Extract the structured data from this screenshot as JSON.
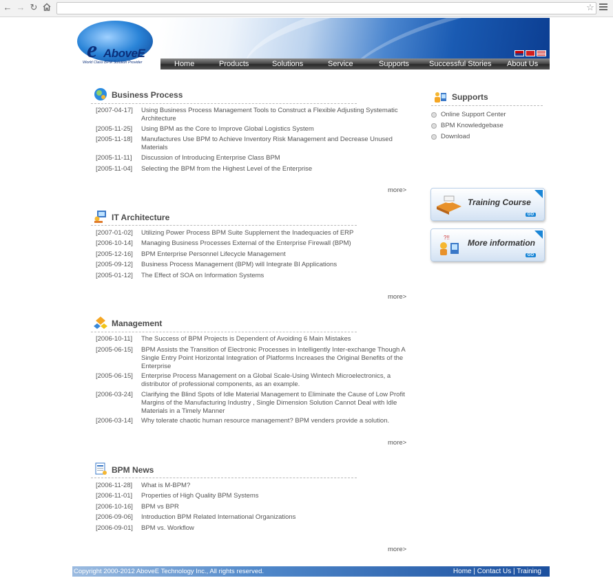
{
  "browser": {
    "address": ""
  },
  "header": {
    "logo_text": "AboveE",
    "logo_tagline": "World Class BPM Solution Provider",
    "nav": [
      "Home",
      "Products",
      "Solutions",
      "Service",
      "Supports",
      "Successful Stories",
      "About Us"
    ],
    "colors": {
      "nav_bar": "#3a3a3a",
      "banner_blue": "#1a5bb3"
    }
  },
  "sections": [
    {
      "title": "Business Process",
      "icon": "globe-people-icon",
      "more": "more>",
      "items": [
        {
          "date": "[2007-04-17]",
          "title": "Using Business Process Management Tools to Construct a Flexible Adjusting Systematic Architecture"
        },
        {
          "date": "[2005-11-25]",
          "title": "Using BPM as the Core to Improve Global Logistics System"
        },
        {
          "date": "[2005-11-18]",
          "title": "Manufactures Use BPM to Achieve Inventory Risk Management and Decrease Unused Materials"
        },
        {
          "date": "[2005-11-11]",
          "title": "Discussion of Introducing Enterprise Class BPM"
        },
        {
          "date": "[2005-11-04]",
          "title": "Selecting the BPM from the Highest Level of the Enterprise"
        }
      ]
    },
    {
      "title": "IT Architecture",
      "icon": "computer-user-icon",
      "more": "more>",
      "items": [
        {
          "date": "[2007-01-02]",
          "title": "Utilizing Power Process BPM Suite Supplement the Inadequacies of ERP"
        },
        {
          "date": "[2006-10-14]",
          "title": "Managing Business Processes External of the Enterprise Firewall (BPM)"
        },
        {
          "date": "[2005-12-16]",
          "title": "BPM Enterprise Personnel Lifecycle Management"
        },
        {
          "date": "[2005-09-12]",
          "title": "Business Process Management (BPM) will Integrate BI Applications"
        },
        {
          "date": "[2005-01-12]",
          "title": "The Effect of SOA on Information Systems"
        }
      ]
    },
    {
      "title": "Management",
      "icon": "puzzle-blocks-icon",
      "more": "more>",
      "items": [
        {
          "date": "[2006-10-11]",
          "title": "The Success of BPM Projects is Dependent of Avoiding 6 Main Mistakes"
        },
        {
          "date": "[2005-06-15]",
          "title": "BPM Assists the Transition of Electronic Processes in Intelligently Inter-exchange Though A Single Entry Point Horizontal Integration of Platforms Increases the Original Benefits of the Enterprise"
        },
        {
          "date": "[2005-06-15]",
          "title": "Enterprise Process Management on a Global Scale-Using Wintech Microelectronics, a distributor of professional components, as an example."
        },
        {
          "date": "[2006-03-24]",
          "title": "Clarifying the Blind Spots of Idle Material Management to Eliminate the Cause of Low Profit Margins of the Manufacturing Industry , Single Dimension Solution Cannot Deal with Idle Materials in a Timely Manner"
        },
        {
          "date": "[2006-03-14]",
          "title": "Why tolerate chaotic human resource management? BPM venders provide a solution."
        }
      ]
    },
    {
      "title": "BPM News",
      "icon": "news-document-icon",
      "more": "more>",
      "items": [
        {
          "date": "[2006-11-28]",
          "title": "What is M-BPM?"
        },
        {
          "date": "[2006-11-01]",
          "title": "Properties of High Quality BPM Systems"
        },
        {
          "date": "[2006-10-16]",
          "title": "BPM vs BPR"
        },
        {
          "date": "[2006-09-06]",
          "title": "Introduction BPM Related International Organizations"
        },
        {
          "date": "[2006-09-01]",
          "title": "BPM vs. Workflow"
        }
      ]
    }
  ],
  "sidebar": {
    "title": "Supports",
    "items": [
      "Online Support Center",
      "BPM Knowledgebase",
      "Download"
    ],
    "promos": [
      {
        "label": "Training Course",
        "go": "GO",
        "icon": "coffee-book-icon"
      },
      {
        "label": "More information",
        "go": "GO",
        "icon": "question-people-icon"
      }
    ]
  },
  "footer": {
    "copyright": "Copyright 2000-2012 AboveE Technology Inc., All rights reserved.",
    "links": [
      "Home",
      "Contact Us",
      "Training"
    ],
    "separator": "|"
  }
}
